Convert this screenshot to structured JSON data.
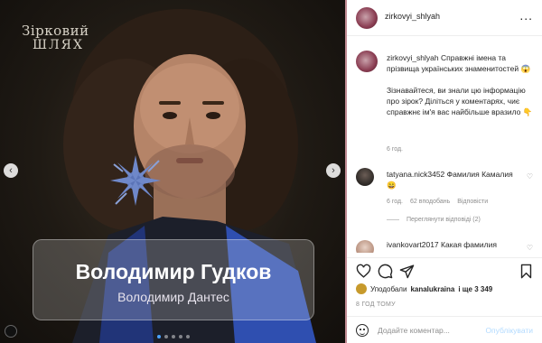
{
  "post": {
    "brand_line1": "Зірковий",
    "brand_line2": "ШЛЯХ",
    "name_main": "Володимир Гудков",
    "name_sub": "Володимир Дантес",
    "arrow_left": "‹",
    "arrow_right": "›",
    "carousel_slides": 5,
    "carousel_active": 1
  },
  "header": {
    "username": "zirkovyi_shlyah",
    "more": "..."
  },
  "caption": {
    "username": "zirkovyi_shlyah",
    "text1": "Справжні імена та прізвища українських знаменитостей 😱",
    "text2": "Зізнавайтеся, ви знали цю інформацію про зірок? Діліться у коментарях, чиє справжнє ім'я вас найбільше вразило 👇",
    "time": "6 год."
  },
  "comments": [
    {
      "username": "tatyana.nick3452",
      "text": "Фамилия Камалия😄",
      "time": "6 год.",
      "likes": "62 вподобань",
      "reply": "Відповісти",
      "view_replies": "Переглянути відповіді (2)"
    },
    {
      "username": "ivankovart2017",
      "text": "Какая фамилия"
    }
  ],
  "likes": {
    "liked_by_prefix": "Уподобали",
    "liked_by_user": "kanalukraina",
    "liked_by_suffix": "і ще 3 349"
  },
  "posted_time": "8 ГОД ТОМУ",
  "add_comment": {
    "placeholder": "Додайте коментар...",
    "publish": "Опублікувати"
  },
  "icons": {
    "like": "heart-icon",
    "comment": "comment-icon",
    "share": "send-icon",
    "save": "bookmark-icon",
    "emoji": "emoji-icon",
    "comment_like": "small-heart-icon"
  },
  "colors": {
    "background": "#bf8a92",
    "publish_disabled": "#b3dbff",
    "carousel_active": "#4aa3ff",
    "muted_text": "#8e8e8e"
  }
}
